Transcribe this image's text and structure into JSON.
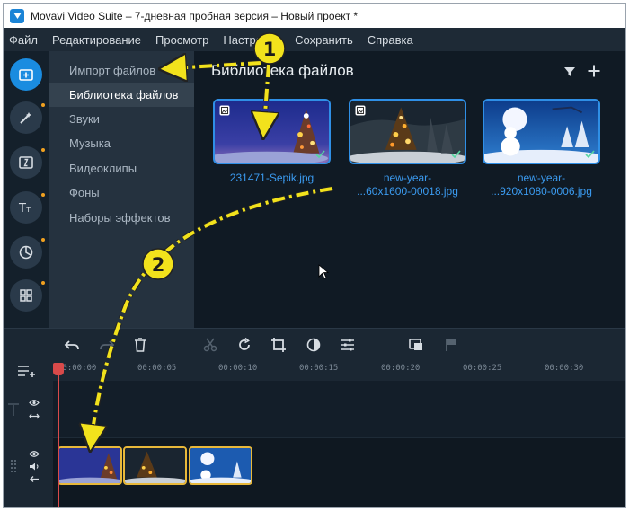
{
  "window": {
    "title": "Movavi Video Suite – 7-дневная пробная версия – Новый проект *"
  },
  "menu": [
    {
      "label": "Файл",
      "mnemonic": "Ф",
      "rest": "айл"
    },
    {
      "label": "Редактирование",
      "mnemonic": "Р",
      "rest": "едактирование"
    },
    {
      "label": "Просмотр",
      "mnemonic": "П",
      "rest": "росмотр"
    },
    {
      "label": "Настройки",
      "mnemonic": "Н",
      "rest": "астро"
    },
    {
      "label": "Сохранить",
      "mnemonic": "",
      "rest": "Сохранить"
    },
    {
      "label": "Справка",
      "mnemonic": "С",
      "rest": "правка"
    }
  ],
  "rail": {
    "icons": [
      "import-icon",
      "magic-wand-icon",
      "transitions-icon",
      "titles-icon",
      "stickers-icon",
      "more-tools-icon"
    ],
    "accent": "#1a8ce0"
  },
  "categories": {
    "items": [
      {
        "label": "Импорт файлов"
      },
      {
        "label": "Библиотека файлов"
      },
      {
        "label": "Звуки"
      },
      {
        "label": "Музыка"
      },
      {
        "label": "Видеоклипы"
      },
      {
        "label": "Фоны"
      },
      {
        "label": "Наборы эффектов"
      }
    ],
    "selected_index": 1
  },
  "library": {
    "title": "Библиотека файлов",
    "files": [
      {
        "name_line1": "231471-Sepik.jpg",
        "name_line2": "",
        "checked": true
      },
      {
        "name_line1": "new-year-",
        "name_line2": "...60x1600-00018.jpg",
        "checked": true
      },
      {
        "name_line1": "new-year-",
        "name_line2": "...920x1080-0006.jpg",
        "checked": true
      }
    ]
  },
  "toolbar": {
    "icons": [
      "undo-icon",
      "redo-icon",
      "delete-icon",
      "cut-icon",
      "rotate-icon",
      "crop-icon",
      "color-adjust-icon",
      "properties-icon",
      "overlay-icon",
      "marker-icon"
    ]
  },
  "timeline": {
    "ruler": [
      "00:00:00",
      "00:00:05",
      "00:00:10",
      "00:00:15",
      "00:00:20",
      "00:00:25",
      "00:00:30"
    ],
    "clips": 3
  },
  "annotations": {
    "step1": "1",
    "step2": "2",
    "arrow_color": "#f2e21c"
  }
}
